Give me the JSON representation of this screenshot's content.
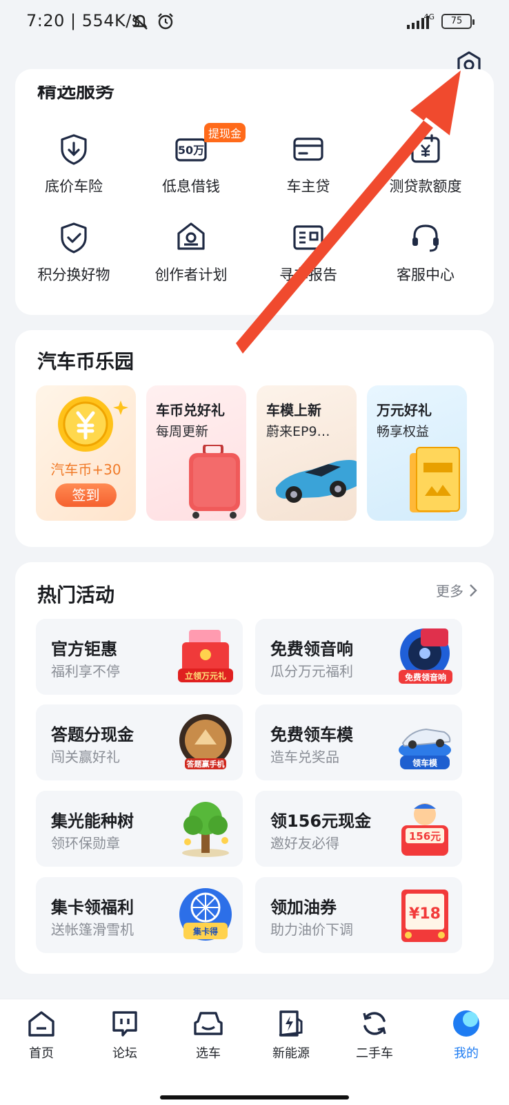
{
  "status_bar": {
    "time": "7:20 | 554K/s",
    "network": "4G",
    "battery": "75"
  },
  "services": {
    "title": "精选服务",
    "items": [
      {
        "label": "底价车险",
        "icon": "shield-download-icon"
      },
      {
        "label": "低息借钱",
        "icon": "fifty-wan-icon",
        "badge": "提现金"
      },
      {
        "label": "车主贷",
        "icon": "card-icon"
      },
      {
        "label": "测贷款额度",
        "icon": "calendar-yen-icon"
      },
      {
        "label": "积分换好物",
        "icon": "shield-check-icon"
      },
      {
        "label": "创作者计划",
        "icon": "creator-house-icon"
      },
      {
        "label": "寻车报告",
        "icon": "report-icon"
      },
      {
        "label": "客服中心",
        "icon": "headset-icon"
      }
    ]
  },
  "coins": {
    "title": "汽车币乐园",
    "checkin_reward": "汽车币+30",
    "checkin_button": "签到",
    "tiles": [
      {
        "title": "车币兑好礼",
        "subtitle": "每周更新"
      },
      {
        "title": "车模上新",
        "subtitle": "蔚来EP9…"
      },
      {
        "title": "万元好礼",
        "subtitle": "畅享权益"
      }
    ]
  },
  "events": {
    "title": "热门活动",
    "more": "更多",
    "items": [
      {
        "title": "官方钜惠",
        "subtitle": "福利享不停",
        "art_text": "立领万元礼"
      },
      {
        "title": "免费领音响",
        "subtitle": "瓜分万元福利",
        "art_text": "免费领音响"
      },
      {
        "title": "答题分现金",
        "subtitle": "闯关赢好礼",
        "art_text": "答题赢手机"
      },
      {
        "title": "免费领车模",
        "subtitle": "造车兑奖品",
        "art_text": "领车模"
      },
      {
        "title": "集光能种树",
        "subtitle": "领环保勋章",
        "art_text": ""
      },
      {
        "title": "领156元现金",
        "subtitle": "邀好友必得",
        "art_text": "156元"
      },
      {
        "title": "集卡领福利",
        "subtitle": "送帐篷滑雪机",
        "art_text": "集卡得"
      },
      {
        "title": "领加油券",
        "subtitle": "助力油价下调",
        "art_text": "¥18"
      }
    ]
  },
  "nav": {
    "items": [
      {
        "label": "首页",
        "icon": "home-icon"
      },
      {
        "label": "论坛",
        "icon": "forum-icon"
      },
      {
        "label": "选车",
        "icon": "car-icon"
      },
      {
        "label": "新能源",
        "icon": "charging-icon"
      },
      {
        "label": "二手车",
        "icon": "refresh-icon"
      },
      {
        "label": "我的",
        "icon": "profile-icon"
      }
    ]
  },
  "colors": {
    "accent_orange": "#ff6a1a",
    "annotation_red": "#f04a2e",
    "text_dark": "#1a1c20",
    "text_gray": "#8a8e96"
  }
}
